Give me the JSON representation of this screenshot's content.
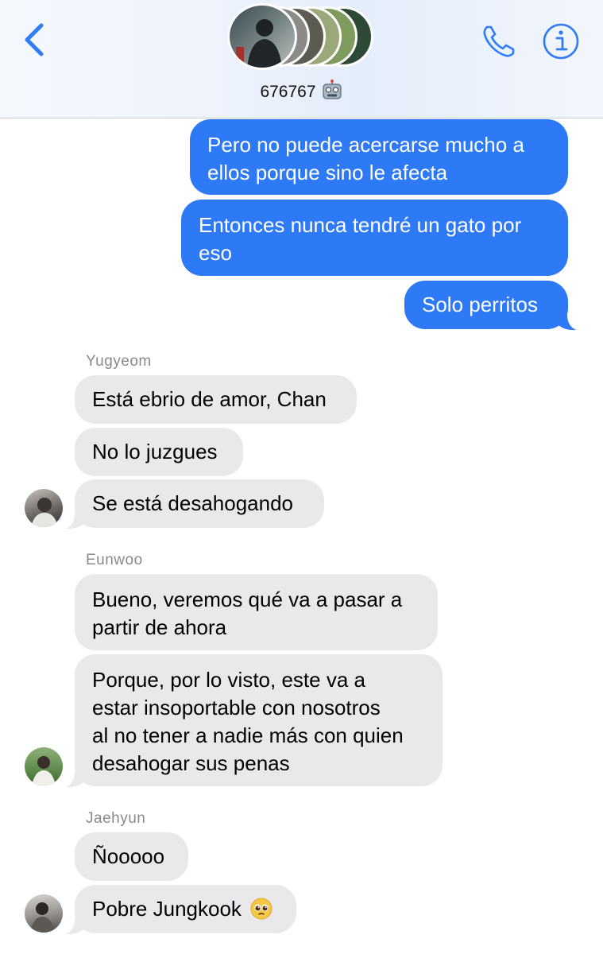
{
  "header": {
    "title": "676767",
    "title_emoji": "robot-face",
    "back_icon": "chevron-left-icon",
    "call_icon": "phone-icon",
    "info_icon": "info-icon",
    "accent": "#2f7cf6"
  },
  "messages": {
    "out1": "Pero no puede acercarse mucho a\nellos porque sino le afecta",
    "out2": "Entonces nunca tendré un gato por\neso",
    "out3": "Solo perritos",
    "yugyeom": {
      "name": "Yugyeom",
      "m1": "Está ebrio de amor, Chan",
      "m2": "No lo juzgues",
      "m3": "Se está desahogando"
    },
    "eunwoo": {
      "name": "Eunwoo",
      "m1": "Bueno, veremos qué va a pasar a\npartir de ahora",
      "m2": "Porque, por lo visto, este va a\nestar insoportable con nosotros\nal no tener a nadie más con quien\ndesahogar sus penas"
    },
    "jaehyun": {
      "name": "Jaehyun",
      "m1": "Ñooooo",
      "m2": "Pobre Jungkook",
      "m2_emoji": "pleading-face"
    }
  },
  "colors": {
    "outgoing": "#2e7af6",
    "incoming": "#e9e9eb",
    "sender_name": "#8a8a8e"
  }
}
